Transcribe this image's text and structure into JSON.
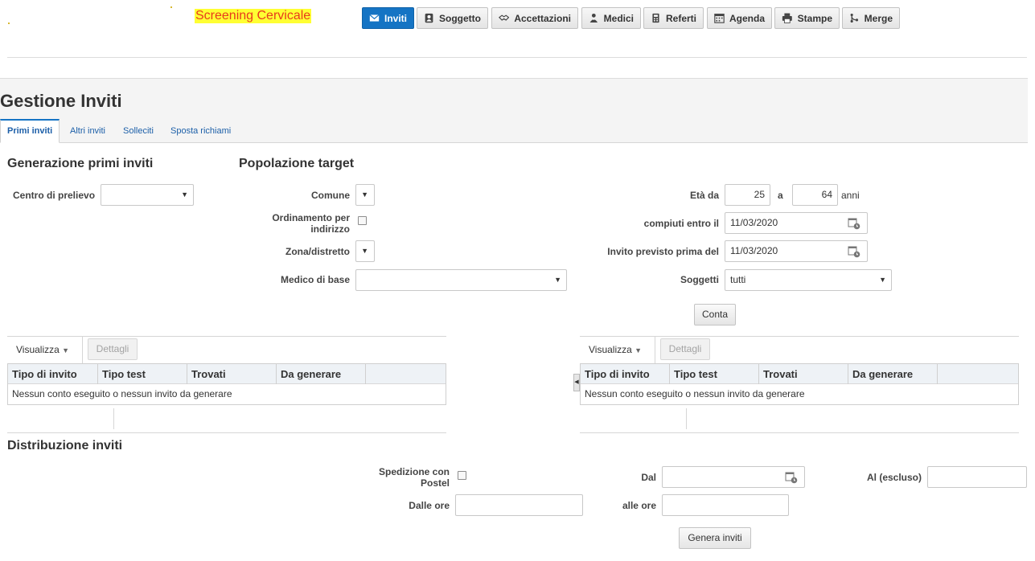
{
  "app": {
    "title": "Screening Cervicale"
  },
  "nav": [
    {
      "label": "Inviti",
      "icon": "envelope-icon",
      "active": true
    },
    {
      "label": "Soggetto",
      "icon": "person-icon"
    },
    {
      "label": "Accettazioni",
      "icon": "handshake-icon"
    },
    {
      "label": "Medici",
      "icon": "doctor-icon"
    },
    {
      "label": "Referti",
      "icon": "calculator-icon"
    },
    {
      "label": "Agenda",
      "icon": "calendar-icon"
    },
    {
      "label": "Stampe",
      "icon": "printer-icon"
    },
    {
      "label": "Merge",
      "icon": "merge-icon"
    }
  ],
  "page": {
    "title": "Gestione Inviti",
    "tabs": [
      "Primi inviti",
      "Altri inviti",
      "Solleciti",
      "Sposta richiami"
    ]
  },
  "generazione": {
    "title": "Generazione primi inviti",
    "centro_label": "Centro di prelievo",
    "centro_value": ""
  },
  "popolazione": {
    "title": "Popolazione target",
    "comune_label": "Comune",
    "ordinamento_label_1": "Ordinamento per",
    "ordinamento_label_2": "indirizzo",
    "zona_label": "Zona/distretto",
    "medico_label": "Medico di base",
    "eta_label": "Età da",
    "eta_da": "25",
    "eta_a_label": "a",
    "eta_a": "64",
    "anni_label": "anni",
    "compiuti_label": "compiuti entro il",
    "compiuti_value": "11/03/2020",
    "invito_label": "Invito previsto prima del",
    "invito_value": "11/03/2020",
    "soggetti_label": "Soggetti",
    "soggetti_value": "tutti",
    "conta_button": "Conta"
  },
  "tables": {
    "visualizza": "Visualizza",
    "dettagli": "Dettagli",
    "columns": [
      "Tipo di invito",
      "Tipo test",
      "Trovati",
      "Da generare"
    ],
    "empty": "Nessun conto eseguito o nessun invito da generare"
  },
  "distribuzione": {
    "title": "Distribuzione inviti",
    "spedizione_label_1": "Spedizione con",
    "spedizione_label_2": "Postel",
    "dal_label": "Dal",
    "al_label": "Al (escluso)",
    "dalle_ore_label": "Dalle ore",
    "alle_ore_label": "alle ore",
    "genera_button": "Genera inviti"
  }
}
